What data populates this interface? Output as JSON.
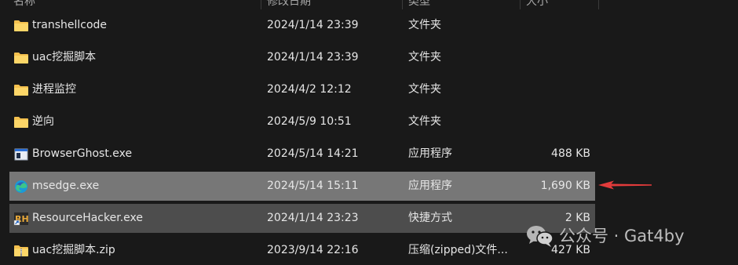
{
  "columns": {
    "name": "名称",
    "date": "修改日期",
    "type": "类型",
    "size": "大小"
  },
  "files": [
    {
      "name": "transhellcode",
      "date": "2024/1/14 23:39",
      "type": "文件夹",
      "size": "",
      "icon": "folder-icon"
    },
    {
      "name": "uac挖掘脚本",
      "date": "2024/1/14 23:39",
      "type": "文件夹",
      "size": "",
      "icon": "folder-icon"
    },
    {
      "name": "进程监控",
      "date": "2024/4/2 12:12",
      "type": "文件夹",
      "size": "",
      "icon": "folder-icon"
    },
    {
      "name": "逆向",
      "date": "2024/5/9 10:51",
      "type": "文件夹",
      "size": "",
      "icon": "folder-icon"
    },
    {
      "name": "BrowserGhost.exe",
      "date": "2024/5/14 14:21",
      "type": "应用程序",
      "size": "488 KB",
      "icon": "exe-window-icon"
    },
    {
      "name": "msedge.exe",
      "date": "2024/5/14 15:11",
      "type": "应用程序",
      "size": "1,690 KB",
      "icon": "edge-browser-icon"
    },
    {
      "name": "ResourceHacker.exe",
      "date": "2024/1/14 23:23",
      "type": "快捷方式",
      "size": "2 KB",
      "icon": "resource-hacker-shortcut-icon"
    },
    {
      "name": "uac挖掘脚本.zip",
      "date": "2023/9/14 22:16",
      "type": "压缩(zipped)文件...",
      "size": "427 KB",
      "icon": "zip-folder-icon"
    }
  ],
  "annotation": {
    "arrow_color": "#e23b3b"
  },
  "watermark": {
    "text": "公众号 · Gat4by",
    "icon": "wechat-icon"
  },
  "colors": {
    "background": "#191919",
    "selected_row": "#777777",
    "hover_row": "#4d4d4d",
    "folder": "#f4c04e"
  }
}
